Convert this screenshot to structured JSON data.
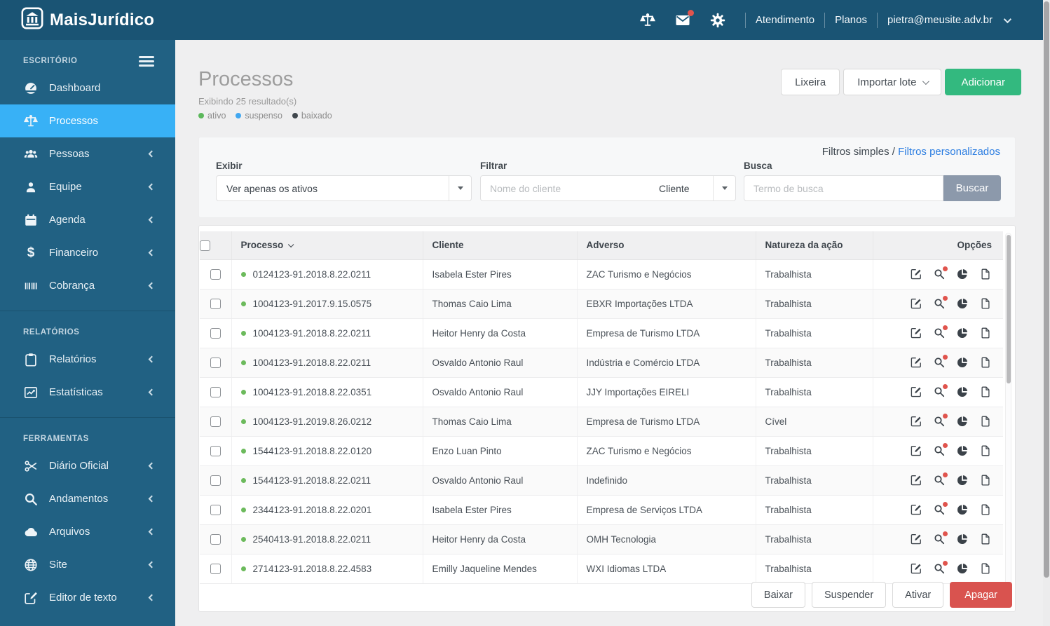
{
  "topbar": {
    "brand": "MaisJurídico",
    "icons": [
      "balance-icon",
      "mail-icon",
      "gear-icon"
    ],
    "menu": [
      {
        "label": "Atendimento"
      },
      {
        "label": "Planos"
      }
    ],
    "account": {
      "email": "pietra@meusite.adv.br"
    }
  },
  "sidebar": {
    "sections": [
      {
        "title": "ESCRITÓRIO",
        "items": [
          {
            "label": "Dashboard",
            "icon": "gauge-icon",
            "active": false,
            "expandable": false
          },
          {
            "label": "Processos",
            "icon": "balance-icon",
            "active": true,
            "expandable": false
          },
          {
            "label": "Pessoas",
            "icon": "users-icon",
            "active": false,
            "expandable": true
          },
          {
            "label": "Equipe",
            "icon": "user-icon",
            "active": false,
            "expandable": true
          },
          {
            "label": "Agenda",
            "icon": "calendar-icon",
            "active": false,
            "expandable": true
          },
          {
            "label": "Financeiro",
            "icon": "dollar-icon",
            "active": false,
            "expandable": true
          },
          {
            "label": "Cobrança",
            "icon": "barcode-icon",
            "active": false,
            "expandable": true
          }
        ]
      },
      {
        "title": "RELATÓRIOS",
        "items": [
          {
            "label": "Relatórios",
            "icon": "clipboard-icon",
            "active": false,
            "expandable": true
          },
          {
            "label": "Estatísticas",
            "icon": "line-chart-icon",
            "active": false,
            "expandable": true
          }
        ]
      },
      {
        "title": "FERRAMENTAS",
        "items": [
          {
            "label": "Diário Oficial",
            "icon": "scissors-icon",
            "active": false,
            "expandable": true
          },
          {
            "label": "Andamentos",
            "icon": "search-icon",
            "active": false,
            "expandable": true
          },
          {
            "label": "Arquivos",
            "icon": "cloud-icon",
            "active": false,
            "expandable": true
          },
          {
            "label": "Site",
            "icon": "globe-icon",
            "active": false,
            "expandable": true
          },
          {
            "label": "Editor de texto",
            "icon": "edit-square-icon",
            "active": false,
            "expandable": true
          }
        ]
      }
    ]
  },
  "page": {
    "title": "Processos",
    "subtitle": "Exibindo 25 resultado(s)",
    "legend": [
      {
        "label": "ativo",
        "color": "#5cb85c"
      },
      {
        "label": "suspenso",
        "color": "#41a7f0"
      },
      {
        "label": "baixado",
        "color": "#40474d"
      }
    ],
    "actions": {
      "trash": "Lixeira",
      "import": "Importar lote",
      "add": "Adicionar"
    }
  },
  "filters": {
    "mode_simple": "Filtros simples",
    "mode_separator": " / ",
    "mode_custom": "Filtros personalizados",
    "exibir": {
      "label": "Exibir",
      "value": "Ver apenas os ativos"
    },
    "filtrar": {
      "label": "Filtrar",
      "placeholder": "Nome do cliente",
      "select_value": "Cliente"
    },
    "busca": {
      "label": "Busca",
      "placeholder": "Termo de busca",
      "button": "Buscar"
    }
  },
  "table": {
    "columns": [
      "Processo",
      "Cliente",
      "Adverso",
      "Natureza da ação",
      "Opções"
    ],
    "row_actions": [
      "edit-icon",
      "search-icon",
      "pie-chart-icon",
      "file-icon"
    ],
    "rows": [
      {
        "processo": "0124123-91.2018.8.22.0211",
        "cliente": "Isabela Ester Pires",
        "adverso": "ZAC Turismo e Negócios",
        "natureza": "Trabalhista",
        "status": "ativo"
      },
      {
        "processo": "1004123-91.2017.9.15.0575",
        "cliente": "Thomas Caio Lima",
        "adverso": "EBXR Importações LTDA",
        "natureza": "Trabalhista",
        "status": "ativo"
      },
      {
        "processo": "1004123-91.2018.8.22.0211",
        "cliente": "Heitor Henry da Costa",
        "adverso": "Empresa de Turismo LTDA",
        "natureza": "Trabalhista",
        "status": "ativo"
      },
      {
        "processo": "1004123-91.2018.8.22.0211",
        "cliente": "Osvaldo Antonio Raul",
        "adverso": "Indústria e Comércio LTDA",
        "natureza": "Trabalhista",
        "status": "ativo"
      },
      {
        "processo": "1004123-91.2018.8.22.0351",
        "cliente": "Osvaldo Antonio Raul",
        "adverso": "JJY Importações EIRELI",
        "natureza": "Trabalhista",
        "status": "ativo"
      },
      {
        "processo": "1004123-91.2019.8.26.0212",
        "cliente": "Thomas Caio Lima",
        "adverso": "Empresa de Turismo LTDA",
        "natureza": "Cível",
        "status": "ativo"
      },
      {
        "processo": "1544123-91.2018.8.22.0120",
        "cliente": "Enzo Luan Pinto",
        "adverso": "ZAC Turismo e Negócios",
        "natureza": "Trabalhista",
        "status": "ativo"
      },
      {
        "processo": "1544123-91.2018.8.22.0211",
        "cliente": "Osvaldo Antonio Raul",
        "adverso": "Indefinido",
        "natureza": "Trabalhista",
        "status": "ativo"
      },
      {
        "processo": "2344123-91.2018.8.22.0201",
        "cliente": "Isabela Ester Pires",
        "adverso": "Empresa de Serviços LTDA",
        "natureza": "Trabalhista",
        "status": "ativo"
      },
      {
        "processo": "2540413-91.2018.8.22.0211",
        "cliente": "Heitor Henry da Costa",
        "adverso": "OMH Tecnologia",
        "natureza": "Trabalhista",
        "status": "ativo"
      },
      {
        "processo": "2714123-91.2018.8.22.4583",
        "cliente": "Emilly Jaqueline Mendes",
        "adverso": "WXI Idiomas LTDA",
        "natureza": "Trabalhista",
        "status": "ativo"
      }
    ]
  },
  "footer_actions": {
    "baixar": "Baixar",
    "suspender": "Suspender",
    "ativar": "Ativar",
    "apagar": "Apagar"
  },
  "colors": {
    "navbar": "#1a5474",
    "sidebar": "#216183",
    "active_item": "#38b1f6",
    "add_green": "#33b97f",
    "delete_red": "#d9534f",
    "search_gray": "#8c99ab",
    "link_blue": "#2b7de1",
    "status_ativo": "#5cb85c",
    "status_suspenso": "#41a7f0",
    "status_baixado": "#40474d"
  }
}
